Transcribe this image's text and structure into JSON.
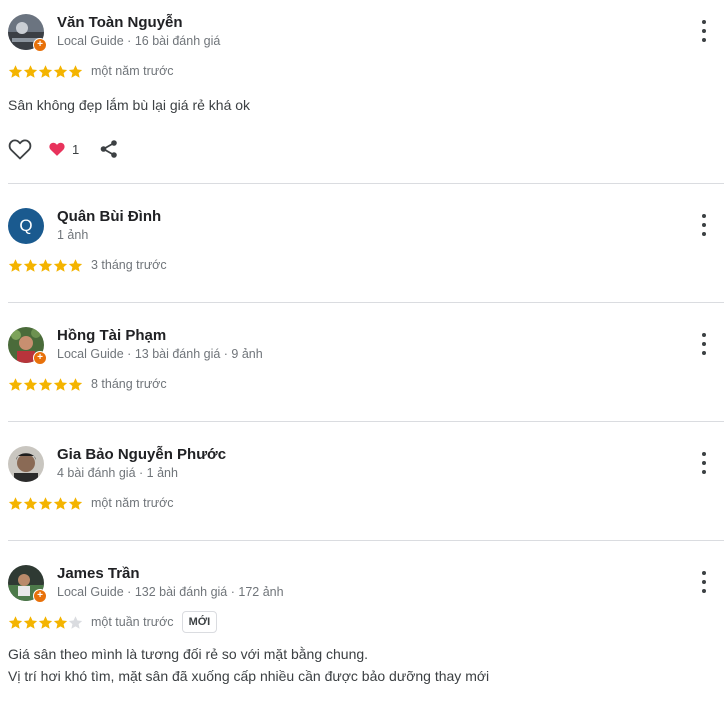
{
  "colors": {
    "star_filled": "#f4b400",
    "star_empty": "#dadce0",
    "guide_badge": "#e8710a",
    "avatar_q": "#1a5a8f",
    "heart": "#e8335c"
  },
  "reviews": [
    {
      "name": "Văn Toàn Nguyễn",
      "meta": "Local Guide · 16 bài đánh giá",
      "rating": 5,
      "time": "một năm trước",
      "text": "Sân không đẹp lắm bù lại giá rẻ khá ok",
      "reactions": "1"
    },
    {
      "name": "Quân Bùi Đình",
      "avatar_letter": "Q",
      "meta": "1 ảnh",
      "rating": 5,
      "time": "3 tháng trước"
    },
    {
      "name": "Hồng Tài Phạm",
      "meta": "Local Guide · 13 bài đánh giá · 9 ảnh",
      "rating": 5,
      "time": "8 tháng trước"
    },
    {
      "name": "Gia Bảo Nguyễn Phước",
      "meta": "4 bài đánh giá · 1 ảnh",
      "rating": 5,
      "time": "một năm trước"
    },
    {
      "name": "James Trần",
      "meta": "Local Guide · 132 bài đánh giá · 172 ảnh",
      "rating": 4,
      "time": "một tuần trước",
      "badge": "MỚI",
      "text_line1": "Giá sân theo mình là tương đối rẻ so với mặt bằng chung.",
      "text_line2": "Vị trí hơi khó tìm, mặt sân đã xuống cấp nhiều cần được bảo dưỡng thay mới"
    }
  ]
}
